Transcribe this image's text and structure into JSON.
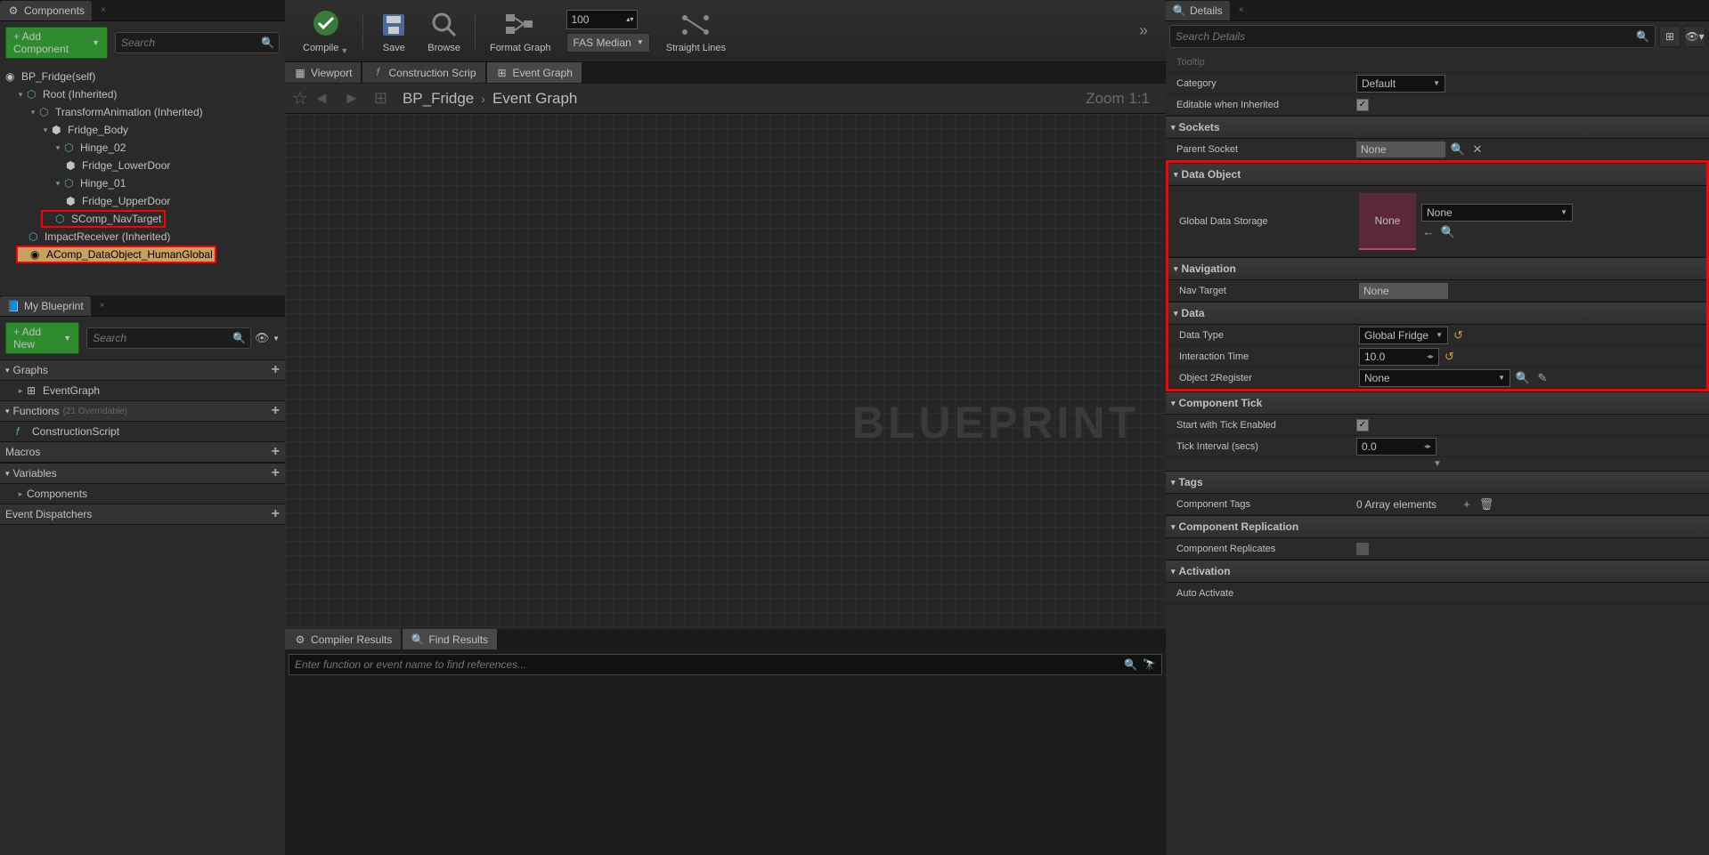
{
  "left": {
    "components_tab": "Components",
    "add_component": "+ Add Component",
    "search_ph": "Search",
    "tree": {
      "root_self": "BP_Fridge(self)",
      "root": "Root (Inherited)",
      "transform": "TransformAnimation (Inherited)",
      "fridge_body": "Fridge_Body",
      "hinge02": "Hinge_02",
      "lower_door": "Fridge_LowerDoor",
      "hinge01": "Hinge_01",
      "upper_door": "Fridge_UpperDoor",
      "navtarget": "SComp_NavTarget",
      "impact": "ImpactReceiver (Inherited)",
      "dataobj": "AComp_DataObject_HumanGlobal"
    },
    "myblueprint_tab": "My Blueprint",
    "add_new": "+ Add New",
    "graphs": "Graphs",
    "eventgraph": "EventGraph",
    "functions": "Functions",
    "functions_count": "(21 Overridable)",
    "construction": "ConstructionScript",
    "macros": "Macros",
    "variables": "Variables",
    "components": "Components",
    "dispatchers": "Event Dispatchers"
  },
  "mid": {
    "toolbar": {
      "compile": "Compile",
      "save": "Save",
      "browse": "Browse",
      "format": "Format Graph",
      "fas_value": "100",
      "fas_median": "FAS Median",
      "straight": "Straight Lines"
    },
    "tabs": {
      "viewport": "Viewport",
      "construction": "Construction Scrip",
      "eventgraph": "Event Graph"
    },
    "crumb": {
      "bp": "BP_Fridge",
      "eg": "Event Graph",
      "zoom": "Zoom 1:1"
    },
    "watermark": "BLUEPRINT",
    "results": {
      "compiler": "Compiler Results",
      "find": "Find Results",
      "find_ph": "Enter function or event name to find references..."
    }
  },
  "right": {
    "tab": "Details",
    "search_ph": "Search Details",
    "tooltip_lbl": "Tooltip",
    "category_lbl": "Category",
    "category_val": "Default",
    "editable_lbl": "Editable when Inherited",
    "sockets_hdr": "Sockets",
    "parent_socket_lbl": "Parent Socket",
    "parent_socket_val": "None",
    "dataobj_hdr": "Data Object",
    "global_storage_lbl": "Global Data Storage",
    "global_storage_thumb": "None",
    "global_storage_combo": "None",
    "nav_hdr": "Navigation",
    "nav_target_lbl": "Nav Target",
    "nav_target_val": "None",
    "data_hdr": "Data",
    "datatype_lbl": "Data Type",
    "datatype_val": "Global Fridge",
    "itime_lbl": "Interaction Time",
    "itime_val": "10.0",
    "obj2reg_lbl": "Object 2Register",
    "obj2reg_val": "None",
    "tick_hdr": "Component Tick",
    "tick_start_lbl": "Start with Tick Enabled",
    "tick_interval_lbl": "Tick Interval (secs)",
    "tick_interval_val": "0.0",
    "tags_hdr": "Tags",
    "comp_tags_lbl": "Component Tags",
    "comp_tags_val": "0 Array elements",
    "repl_hdr": "Component Replication",
    "repl_lbl": "Component Replicates",
    "activ_hdr": "Activation",
    "auto_act_lbl": "Auto Activate"
  }
}
